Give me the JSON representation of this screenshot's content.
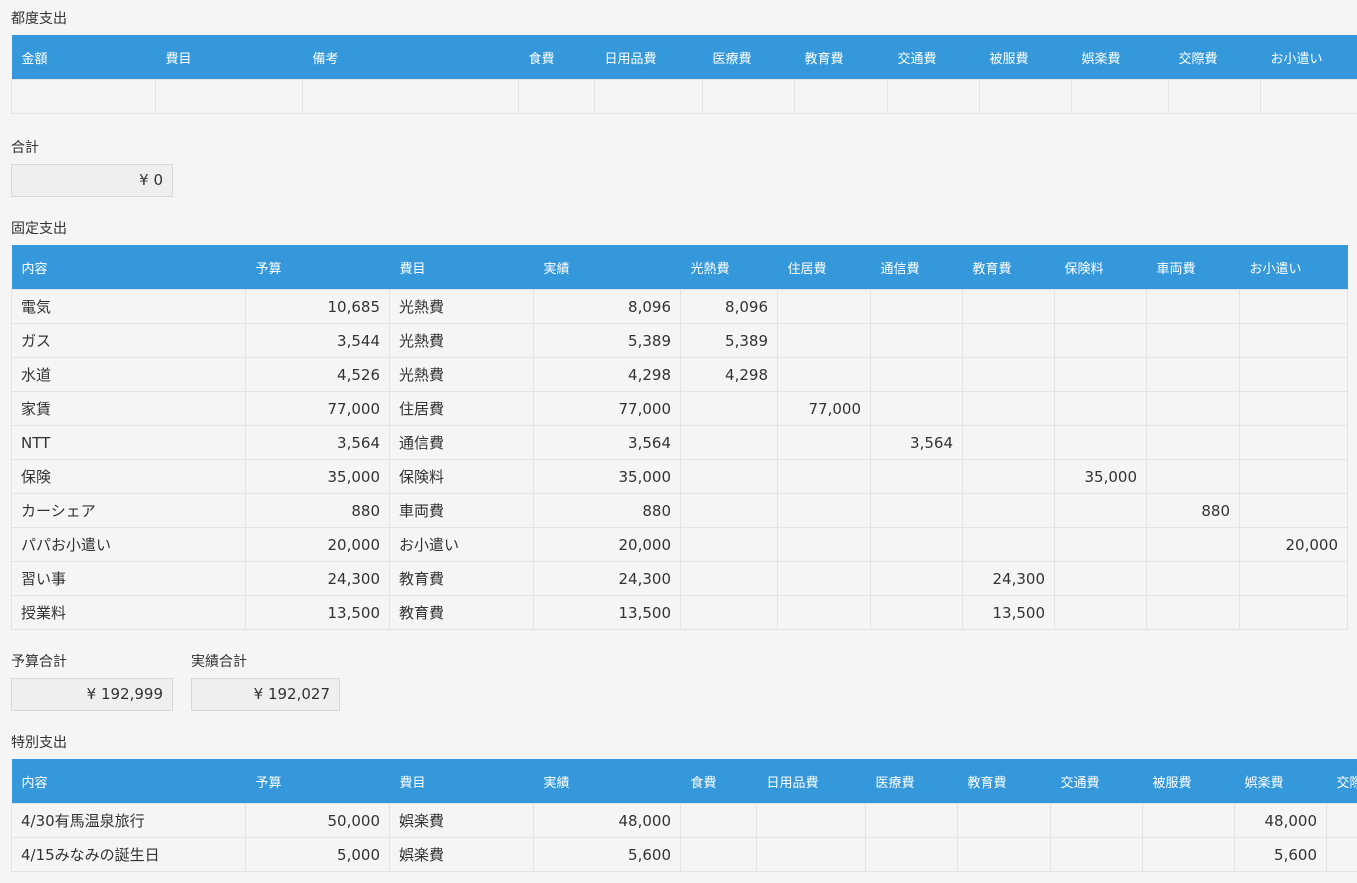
{
  "spot": {
    "title": "都度支出",
    "headers": [
      "金額",
      "費目",
      "備考",
      "食費",
      "日用品費",
      "医療費",
      "教育費",
      "交通費",
      "被服費",
      "娯楽費",
      "交際費",
      "お小遣い"
    ],
    "total_label": "合計",
    "total_value": "¥ 0"
  },
  "fixed": {
    "title": "固定支出",
    "headers": [
      "内容",
      "予算",
      "費目",
      "実績",
      "光熱費",
      "住居費",
      "通信費",
      "教育費",
      "保険料",
      "車両費",
      "お小遣い"
    ],
    "rows": [
      [
        "電気",
        "10,685",
        "光熱費",
        "8,096",
        "8,096",
        "",
        "",
        "",
        "",
        "",
        ""
      ],
      [
        "ガス",
        "3,544",
        "光熱費",
        "5,389",
        "5,389",
        "",
        "",
        "",
        "",
        "",
        ""
      ],
      [
        "水道",
        "4,526",
        "光熱費",
        "4,298",
        "4,298",
        "",
        "",
        "",
        "",
        "",
        ""
      ],
      [
        "家賃",
        "77,000",
        "住居費",
        "77,000",
        "",
        "77,000",
        "",
        "",
        "",
        "",
        ""
      ],
      [
        "NTT",
        "3,564",
        "通信費",
        "3,564",
        "",
        "",
        "3,564",
        "",
        "",
        "",
        ""
      ],
      [
        "保険",
        "35,000",
        "保険料",
        "35,000",
        "",
        "",
        "",
        "",
        "35,000",
        "",
        ""
      ],
      [
        "カーシェア",
        "880",
        "車両費",
        "880",
        "",
        "",
        "",
        "",
        "",
        "880",
        ""
      ],
      [
        "パパお小遣い",
        "20,000",
        "お小遣い",
        "20,000",
        "",
        "",
        "",
        "",
        "",
        "",
        "20,000"
      ],
      [
        "習い事",
        "24,300",
        "教育費",
        "24,300",
        "",
        "",
        "",
        "24,300",
        "",
        "",
        ""
      ],
      [
        "授業料",
        "13,500",
        "教育費",
        "13,500",
        "",
        "",
        "",
        "13,500",
        "",
        "",
        ""
      ]
    ],
    "budget_total_label": "予算合計",
    "budget_total": "¥ 192,999",
    "actual_total_label": "実績合計",
    "actual_total": "¥ 192,027"
  },
  "special": {
    "title": "特別支出",
    "headers": [
      "内容",
      "予算",
      "費目",
      "実績",
      "食費",
      "日用品費",
      "医療費",
      "教育費",
      "交通費",
      "被服費",
      "娯楽費",
      "交際費"
    ],
    "rows": [
      [
        "4/30有馬温泉旅行",
        "50,000",
        "娯楽費",
        "48,000",
        "",
        "",
        "",
        "",
        "",
        "",
        "48,000",
        ""
      ],
      [
        "4/15みなみの誕生日",
        "5,000",
        "娯楽費",
        "5,600",
        "",
        "",
        "",
        "",
        "",
        "",
        "5,600",
        ""
      ]
    ]
  }
}
